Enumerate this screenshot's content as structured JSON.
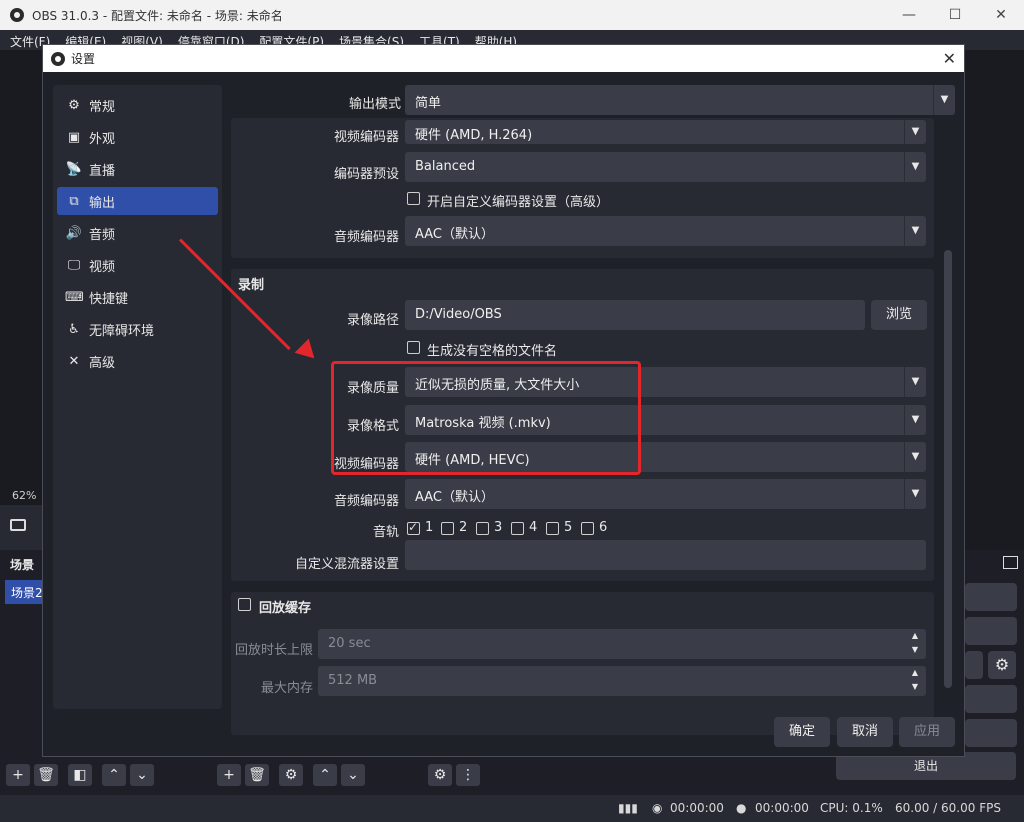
{
  "window": {
    "title": "OBS 31.0.3 - 配置文件: 未命名 - 场景: 未命名",
    "controls": [
      "—",
      "☐",
      "✕"
    ]
  },
  "menu": [
    "文件(F)",
    "编辑(E)",
    "视图(V)",
    "停靠窗口(D)",
    "配置文件(P)",
    "场景集合(S)",
    "工具(T)",
    "帮助(H)"
  ],
  "preview": {
    "zoom": "62%"
  },
  "scenes": {
    "header": "场景",
    "item": "场景2"
  },
  "exit_label": "退出",
  "status": {
    "rec_time1": "00:00:00",
    "rec_time2": "00:00:00",
    "cpu": "CPU: 0.1%",
    "fps": "60.00 / 60.00 FPS"
  },
  "dialog": {
    "title": "设置",
    "close": "✕",
    "sidebar": [
      {
        "label": "常规",
        "icon": "gear-icon",
        "glyph": "⚙"
      },
      {
        "label": "外观",
        "icon": "appearance-icon",
        "glyph": "▣"
      },
      {
        "label": "直播",
        "icon": "broadcast-icon",
        "glyph": "📡"
      },
      {
        "label": "输出",
        "icon": "output-icon",
        "glyph": "⧉"
      },
      {
        "label": "音频",
        "icon": "speaker-icon",
        "glyph": "🔊"
      },
      {
        "label": "视频",
        "icon": "monitor-icon",
        "glyph": "🖵"
      },
      {
        "label": "快捷键",
        "icon": "keyboard-icon",
        "glyph": "⌨"
      },
      {
        "label": "无障碍环境",
        "icon": "accessibility-icon",
        "glyph": "♿"
      },
      {
        "label": "高级",
        "icon": "tools-icon",
        "glyph": "✕"
      }
    ],
    "output_mode": {
      "label": "输出模式",
      "value": "简单"
    },
    "streaming": {
      "video_encoder": {
        "label": "视频编码器",
        "value": "硬件 (AMD, H.264)"
      },
      "encoder_preset": {
        "label": "编码器预设",
        "value": "Balanced"
      },
      "custom_encoder_check": "开启自定义编码器设置（高级）",
      "audio_encoder": {
        "label": "音频编码器",
        "value": "AAC（默认）"
      }
    },
    "recording": {
      "title": "录制",
      "path": {
        "label": "录像路径",
        "value": "D:/Video/OBS"
      },
      "browse": "浏览",
      "no_space_check": "生成没有空格的文件名",
      "quality": {
        "label": "录像质量",
        "value": "近似无损的质量, 大文件大小"
      },
      "format": {
        "label": "录像格式",
        "value": "Matroska 视频 (.mkv)"
      },
      "video_encoder": {
        "label": "视频编码器",
        "value": "硬件 (AMD, HEVC)"
      },
      "audio_encoder": {
        "label": "音频编码器",
        "value": "AAC（默认）"
      },
      "tracks_label": "音轨",
      "tracks": [
        "1",
        "2",
        "3",
        "4",
        "5",
        "6"
      ],
      "muxer_label": "自定义混流器设置",
      "muxer_value": ""
    },
    "replay": {
      "title": "回放缓存",
      "max_time": {
        "label": "回放时长上限",
        "value": "20 sec"
      },
      "max_mem": {
        "label": "最大内存",
        "value": "512 MB"
      }
    },
    "buttons": {
      "ok": "确定",
      "cancel": "取消",
      "apply": "应用"
    }
  }
}
